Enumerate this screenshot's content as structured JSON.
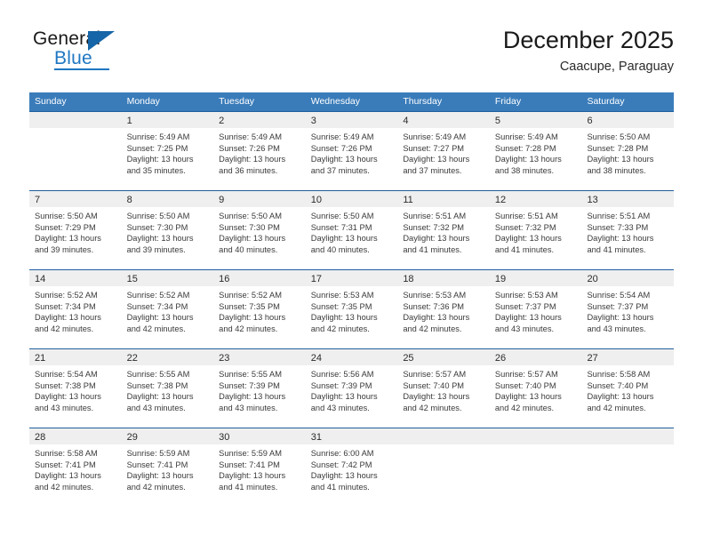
{
  "brand": {
    "name_top": "General",
    "name_bottom": "Blue",
    "accent_color": "#1f77c2",
    "triangle_color": "#1565a8"
  },
  "header": {
    "title": "December 2025",
    "subtitle": "Caacupe, Paraguay"
  },
  "theme": {
    "header_band": "#3a7cba",
    "week_separator": "#1f5f9e",
    "date_strip": "#efefef",
    "text": "#2b2b2b"
  },
  "weekday_headers": [
    "Sunday",
    "Monday",
    "Tuesday",
    "Wednesday",
    "Thursday",
    "Friday",
    "Saturday"
  ],
  "labels": {
    "sunrise_prefix": "Sunrise:",
    "sunset_prefix": "Sunset:",
    "daylight_prefix": "Daylight:"
  },
  "weeks": [
    [
      {
        "day": "",
        "sunrise": "",
        "sunset": "",
        "daylight_line1": "",
        "daylight_line2": ""
      },
      {
        "day": "1",
        "sunrise": "Sunrise: 5:49 AM",
        "sunset": "Sunset: 7:25 PM",
        "daylight_line1": "Daylight: 13 hours",
        "daylight_line2": "and 35 minutes."
      },
      {
        "day": "2",
        "sunrise": "Sunrise: 5:49 AM",
        "sunset": "Sunset: 7:26 PM",
        "daylight_line1": "Daylight: 13 hours",
        "daylight_line2": "and 36 minutes."
      },
      {
        "day": "3",
        "sunrise": "Sunrise: 5:49 AM",
        "sunset": "Sunset: 7:26 PM",
        "daylight_line1": "Daylight: 13 hours",
        "daylight_line2": "and 37 minutes."
      },
      {
        "day": "4",
        "sunrise": "Sunrise: 5:49 AM",
        "sunset": "Sunset: 7:27 PM",
        "daylight_line1": "Daylight: 13 hours",
        "daylight_line2": "and 37 minutes."
      },
      {
        "day": "5",
        "sunrise": "Sunrise: 5:49 AM",
        "sunset": "Sunset: 7:28 PM",
        "daylight_line1": "Daylight: 13 hours",
        "daylight_line2": "and 38 minutes."
      },
      {
        "day": "6",
        "sunrise": "Sunrise: 5:50 AM",
        "sunset": "Sunset: 7:28 PM",
        "daylight_line1": "Daylight: 13 hours",
        "daylight_line2": "and 38 minutes."
      }
    ],
    [
      {
        "day": "7",
        "sunrise": "Sunrise: 5:50 AM",
        "sunset": "Sunset: 7:29 PM",
        "daylight_line1": "Daylight: 13 hours",
        "daylight_line2": "and 39 minutes."
      },
      {
        "day": "8",
        "sunrise": "Sunrise: 5:50 AM",
        "sunset": "Sunset: 7:30 PM",
        "daylight_line1": "Daylight: 13 hours",
        "daylight_line2": "and 39 minutes."
      },
      {
        "day": "9",
        "sunrise": "Sunrise: 5:50 AM",
        "sunset": "Sunset: 7:30 PM",
        "daylight_line1": "Daylight: 13 hours",
        "daylight_line2": "and 40 minutes."
      },
      {
        "day": "10",
        "sunrise": "Sunrise: 5:50 AM",
        "sunset": "Sunset: 7:31 PM",
        "daylight_line1": "Daylight: 13 hours",
        "daylight_line2": "and 40 minutes."
      },
      {
        "day": "11",
        "sunrise": "Sunrise: 5:51 AM",
        "sunset": "Sunset: 7:32 PM",
        "daylight_line1": "Daylight: 13 hours",
        "daylight_line2": "and 41 minutes."
      },
      {
        "day": "12",
        "sunrise": "Sunrise: 5:51 AM",
        "sunset": "Sunset: 7:32 PM",
        "daylight_line1": "Daylight: 13 hours",
        "daylight_line2": "and 41 minutes."
      },
      {
        "day": "13",
        "sunrise": "Sunrise: 5:51 AM",
        "sunset": "Sunset: 7:33 PM",
        "daylight_line1": "Daylight: 13 hours",
        "daylight_line2": "and 41 minutes."
      }
    ],
    [
      {
        "day": "14",
        "sunrise": "Sunrise: 5:52 AM",
        "sunset": "Sunset: 7:34 PM",
        "daylight_line1": "Daylight: 13 hours",
        "daylight_line2": "and 42 minutes."
      },
      {
        "day": "15",
        "sunrise": "Sunrise: 5:52 AM",
        "sunset": "Sunset: 7:34 PM",
        "daylight_line1": "Daylight: 13 hours",
        "daylight_line2": "and 42 minutes."
      },
      {
        "day": "16",
        "sunrise": "Sunrise: 5:52 AM",
        "sunset": "Sunset: 7:35 PM",
        "daylight_line1": "Daylight: 13 hours",
        "daylight_line2": "and 42 minutes."
      },
      {
        "day": "17",
        "sunrise": "Sunrise: 5:53 AM",
        "sunset": "Sunset: 7:35 PM",
        "daylight_line1": "Daylight: 13 hours",
        "daylight_line2": "and 42 minutes."
      },
      {
        "day": "18",
        "sunrise": "Sunrise: 5:53 AM",
        "sunset": "Sunset: 7:36 PM",
        "daylight_line1": "Daylight: 13 hours",
        "daylight_line2": "and 42 minutes."
      },
      {
        "day": "19",
        "sunrise": "Sunrise: 5:53 AM",
        "sunset": "Sunset: 7:37 PM",
        "daylight_line1": "Daylight: 13 hours",
        "daylight_line2": "and 43 minutes."
      },
      {
        "day": "20",
        "sunrise": "Sunrise: 5:54 AM",
        "sunset": "Sunset: 7:37 PM",
        "daylight_line1": "Daylight: 13 hours",
        "daylight_line2": "and 43 minutes."
      }
    ],
    [
      {
        "day": "21",
        "sunrise": "Sunrise: 5:54 AM",
        "sunset": "Sunset: 7:38 PM",
        "daylight_line1": "Daylight: 13 hours",
        "daylight_line2": "and 43 minutes."
      },
      {
        "day": "22",
        "sunrise": "Sunrise: 5:55 AM",
        "sunset": "Sunset: 7:38 PM",
        "daylight_line1": "Daylight: 13 hours",
        "daylight_line2": "and 43 minutes."
      },
      {
        "day": "23",
        "sunrise": "Sunrise: 5:55 AM",
        "sunset": "Sunset: 7:39 PM",
        "daylight_line1": "Daylight: 13 hours",
        "daylight_line2": "and 43 minutes."
      },
      {
        "day": "24",
        "sunrise": "Sunrise: 5:56 AM",
        "sunset": "Sunset: 7:39 PM",
        "daylight_line1": "Daylight: 13 hours",
        "daylight_line2": "and 43 minutes."
      },
      {
        "day": "25",
        "sunrise": "Sunrise: 5:57 AM",
        "sunset": "Sunset: 7:40 PM",
        "daylight_line1": "Daylight: 13 hours",
        "daylight_line2": "and 42 minutes."
      },
      {
        "day": "26",
        "sunrise": "Sunrise: 5:57 AM",
        "sunset": "Sunset: 7:40 PM",
        "daylight_line1": "Daylight: 13 hours",
        "daylight_line2": "and 42 minutes."
      },
      {
        "day": "27",
        "sunrise": "Sunrise: 5:58 AM",
        "sunset": "Sunset: 7:40 PM",
        "daylight_line1": "Daylight: 13 hours",
        "daylight_line2": "and 42 minutes."
      }
    ],
    [
      {
        "day": "28",
        "sunrise": "Sunrise: 5:58 AM",
        "sunset": "Sunset: 7:41 PM",
        "daylight_line1": "Daylight: 13 hours",
        "daylight_line2": "and 42 minutes."
      },
      {
        "day": "29",
        "sunrise": "Sunrise: 5:59 AM",
        "sunset": "Sunset: 7:41 PM",
        "daylight_line1": "Daylight: 13 hours",
        "daylight_line2": "and 42 minutes."
      },
      {
        "day": "30",
        "sunrise": "Sunrise: 5:59 AM",
        "sunset": "Sunset: 7:41 PM",
        "daylight_line1": "Daylight: 13 hours",
        "daylight_line2": "and 41 minutes."
      },
      {
        "day": "31",
        "sunrise": "Sunrise: 6:00 AM",
        "sunset": "Sunset: 7:42 PM",
        "daylight_line1": "Daylight: 13 hours",
        "daylight_line2": "and 41 minutes."
      },
      {
        "day": "",
        "sunrise": "",
        "sunset": "",
        "daylight_line1": "",
        "daylight_line2": ""
      },
      {
        "day": "",
        "sunrise": "",
        "sunset": "",
        "daylight_line1": "",
        "daylight_line2": ""
      },
      {
        "day": "",
        "sunrise": "",
        "sunset": "",
        "daylight_line1": "",
        "daylight_line2": ""
      }
    ]
  ]
}
